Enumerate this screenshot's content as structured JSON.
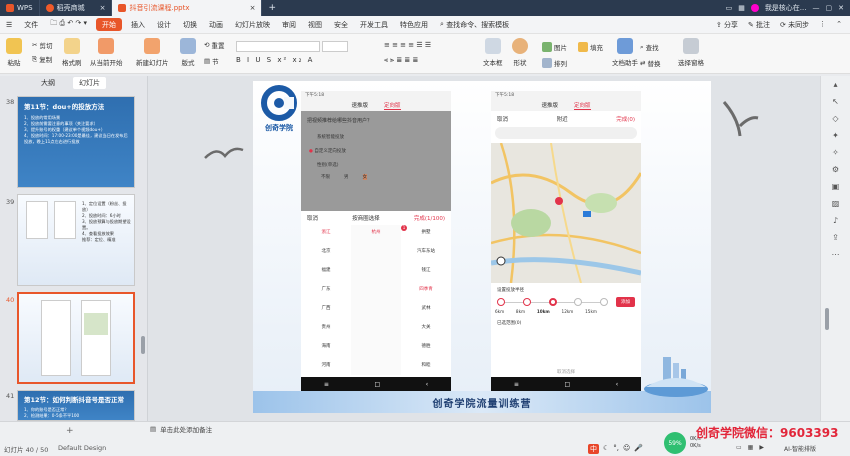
{
  "window": {
    "tabs": [
      {
        "label": "WPS"
      },
      {
        "label": "稻壳商城"
      },
      {
        "label": "抖音引流课程.pptx"
      }
    ],
    "new_tab": "+",
    "right_user": "我是核心在..."
  },
  "menubar": {
    "file": "文件",
    "items": [
      "开始",
      "插入",
      "设计",
      "切换",
      "动画",
      "幻灯片放映",
      "审阅",
      "视图",
      "安全",
      "开发工具",
      "特色应用"
    ],
    "search": "查找命令、搜索模板",
    "share": "分享",
    "comment": "批注",
    "sync": "未同步"
  },
  "ribbon": {
    "paste": "粘贴",
    "cut": "剪切",
    "copy": "复制",
    "format_painter": "格式刷",
    "from_current": "从当前开始",
    "new_slide": "新建幻灯片",
    "layout": "版式",
    "section": "节",
    "reset": "重置",
    "textbox": "文本框",
    "shape": "形状",
    "arrange": "排列",
    "picture": "图片",
    "fill": "填充",
    "find": "查找",
    "replace": "替换",
    "doc_assistant": "文档助手",
    "select_pane": "选择窗格"
  },
  "leftpanel": {
    "tab_outline": "大纲",
    "tab_slides": "幻灯片",
    "slides": [
      {
        "num": "38",
        "title": "第11节：dou+的投放方法",
        "lines": [
          "1、投放的常用场景",
          "2、投放前需要注意的事项（关注要求）",
          "3、提升账号的权重（建议单个视频dou+）",
          "4、投放时间：17:00-23:00是最佳，建议当日在发布后投放，晚上11点左右进行投放"
        ]
      },
      {
        "num": "39",
        "lines": [
          "1、定位设置（粉丝、投放）",
          "2、投放时间：6小时",
          "3、投放预算与投放期望设置。",
          "4、查看投放效果",
          "推荐：定位、精准"
        ]
      },
      {
        "num": "40"
      },
      {
        "num": "41",
        "title": "第12节：如何判断抖音号是否正常",
        "lines": [
          "1、你的账号是否正常？",
          "2、检测结果：0-5条不平100"
        ]
      }
    ]
  },
  "slide": {
    "brand": "创奇学院",
    "footer_banner": "创奇学院流量训练营",
    "phone_left": {
      "status": "下午5:18",
      "tabs": [
        "速推版",
        "定向版"
      ],
      "question": "把视频推荐给哪些抖音用户？",
      "opt1": "系统智能投放",
      "opt2": "自定义定向投放",
      "opt3": "性别(单选)",
      "gender": [
        "不限",
        "男",
        "女"
      ],
      "picker_cancel": "取消",
      "picker_title": "按商圈选择",
      "picker_done": "完成(1/100)",
      "col1": [
        "浙江",
        "北京",
        "福建",
        "广东",
        "广西",
        "贵州",
        "海南",
        "河南"
      ],
      "col2": [
        "杭州"
      ],
      "col3": [
        "拱墅",
        "汽车东站",
        "钱江",
        "四季青",
        "武林",
        "大关",
        "德胜",
        "和睦"
      ],
      "badge": "1"
    },
    "phone_right": {
      "status": "下午5:18",
      "tabs": [
        "速推版",
        "定向版"
      ],
      "cancel": "取消",
      "title": "附近",
      "done": "完成(0)",
      "radius_label": "设置投放半径",
      "radius": [
        "6km",
        "8km",
        "10km",
        "12km",
        "15km"
      ],
      "add": "添加",
      "selected": "已选范围(0)",
      "bottom": "取消选择"
    }
  },
  "statusbar": {
    "slide_count": "幻灯片 40 / 50",
    "theme": "Default Design",
    "notes": "单击此处添加备注",
    "wechat": "创奇学院微信：9603393",
    "battery": "59%",
    "net_up": "0K/s",
    "net_down": "0K/s",
    "ai": "AI-智能排版",
    "ime": "中"
  },
  "colors": {
    "accent": "#e8562a",
    "titlebar": "#2b3a4f",
    "wechat_red": "#e2263a",
    "phone_red": "#e2334a"
  }
}
